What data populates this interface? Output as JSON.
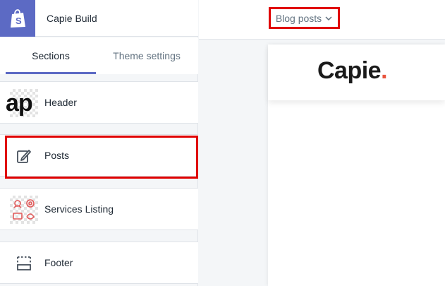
{
  "app": {
    "name": "Capie Build"
  },
  "tabs": {
    "sections": "Sections",
    "theme_settings": "Theme settings"
  },
  "sections": [
    {
      "label": "Header",
      "thumb_text": "ap"
    },
    {
      "label": "Posts"
    },
    {
      "label": "Services Listing"
    },
    {
      "label": "Footer"
    }
  ],
  "topbar": {
    "page_select": "Blog posts"
  },
  "preview": {
    "logo_text": "Capie",
    "logo_dot": "."
  },
  "colors": {
    "accent": "#5c6ac4",
    "highlight": "#e00000",
    "logo_dot": "#e8553e"
  },
  "icons": [
    "shopify-bag-icon",
    "edit-post-icon",
    "services-icon",
    "footer-layout-icon",
    "chevron-down-icon"
  ]
}
